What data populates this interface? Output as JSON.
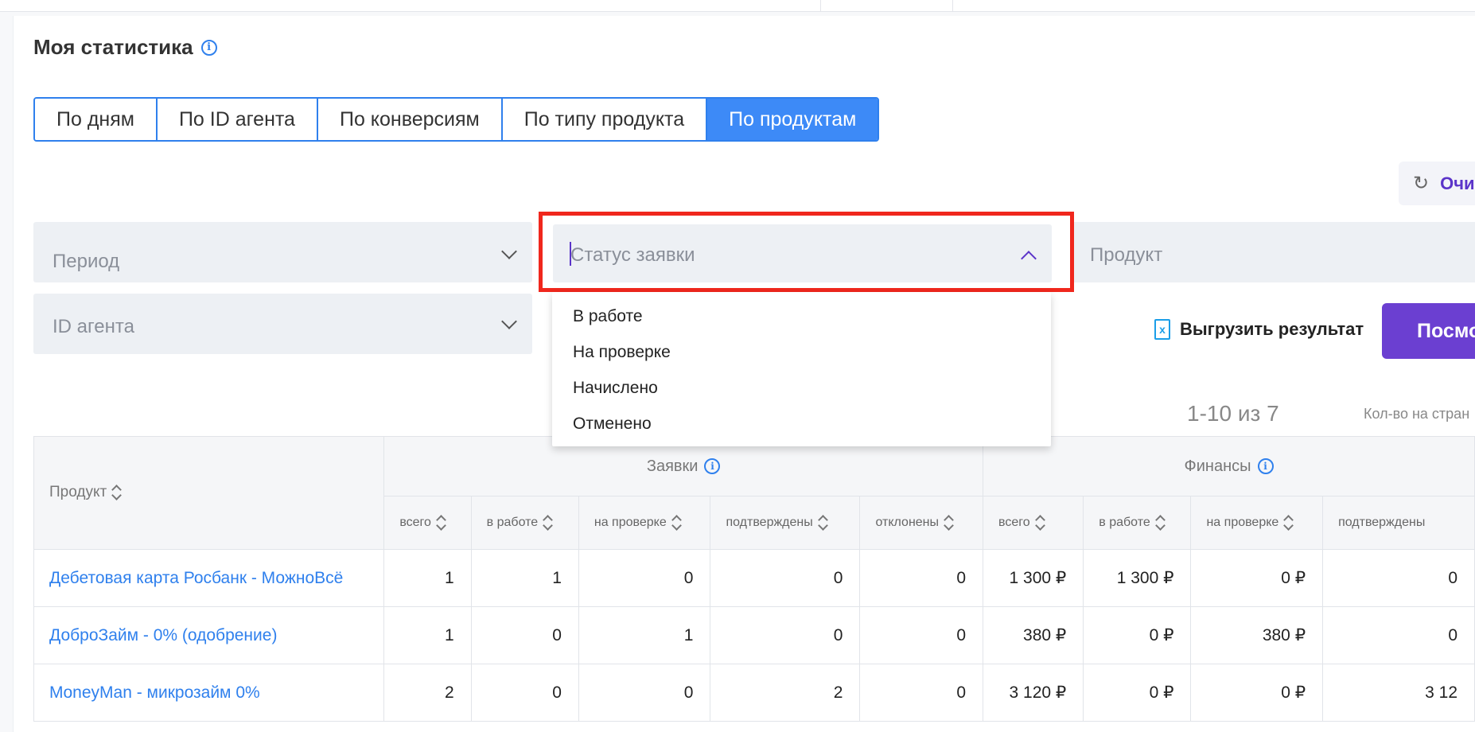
{
  "header": {
    "title": "Моя статистика",
    "info_icon": "info-icon"
  },
  "tabs": [
    {
      "label": "По дням",
      "active": false
    },
    {
      "label": "По ID агента",
      "active": false
    },
    {
      "label": "По конверсиям",
      "active": false
    },
    {
      "label": "По типу продукта",
      "active": false
    },
    {
      "label": "По продуктам",
      "active": true
    }
  ],
  "actions": {
    "clear_label": "Очи",
    "clear_icon": "refresh-icon",
    "export_label": "Выгрузить результат",
    "export_icon": "excel-file-icon",
    "view_label": "Посмо"
  },
  "filters": {
    "period_placeholder": "Период",
    "status_placeholder": "Статус заявки",
    "product_placeholder": "Продукт",
    "agent_placeholder": "ID агента"
  },
  "status_dropdown": {
    "options": [
      "В работе",
      "На проверке",
      "Начислено",
      "Отменено"
    ]
  },
  "pagination": {
    "range": "1-10 из 7",
    "per_page_label": "Кол-во на стран"
  },
  "table": {
    "product_header": "Продукт",
    "group_requests": "Заявки",
    "group_finance": "Финансы",
    "request_columns": [
      "всего",
      "в работе",
      "на проверке",
      "подтверждены",
      "отклонены"
    ],
    "finance_columns": [
      "всего",
      "в работе",
      "на проверке",
      "подтверждены"
    ],
    "rows": [
      {
        "product": "Дебетовая карта Росбанк - МожноВсё",
        "cells": [
          "1",
          "1",
          "0",
          "0",
          "0",
          "1 300 ₽",
          "1 300 ₽",
          "0 ₽",
          "0"
        ]
      },
      {
        "product": "ДоброЗайм - 0% (одобрение)",
        "cells": [
          "1",
          "0",
          "1",
          "0",
          "0",
          "380 ₽",
          "0 ₽",
          "380 ₽",
          "0"
        ]
      },
      {
        "product": "MoneyMan - микрозайм 0%",
        "cells": [
          "2",
          "0",
          "0",
          "2",
          "0",
          "3 120 ₽",
          "0 ₽",
          "0 ₽",
          "3 12"
        ]
      }
    ]
  },
  "colors": {
    "accent_blue": "#2f80ed",
    "active_tab": "#3d8af7",
    "primary_button": "#6b3fd1",
    "highlight_box": "#f0271d"
  }
}
